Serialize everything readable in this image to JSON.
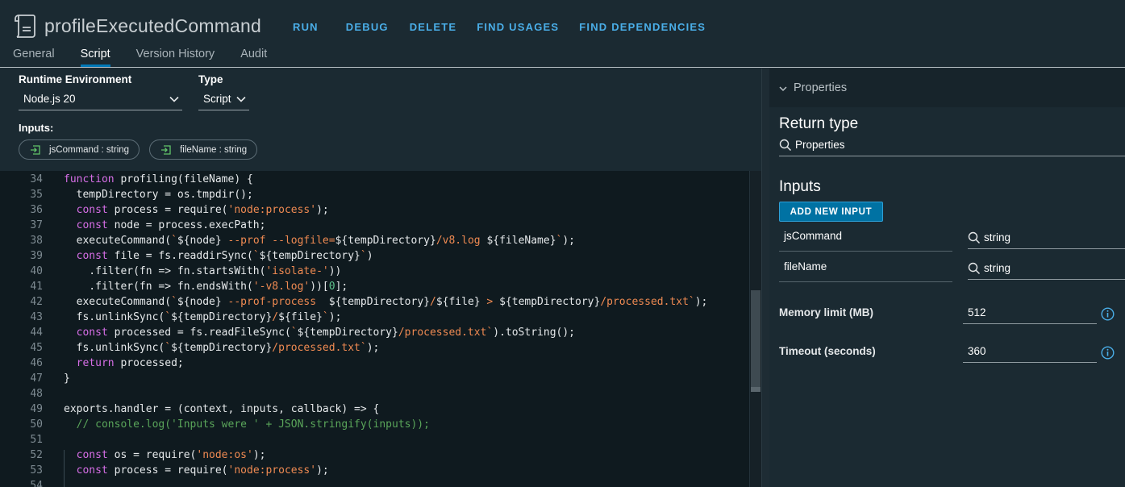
{
  "header": {
    "title": "profileExecutedCommand",
    "actions": [
      "RUN",
      "DEBUG",
      "DELETE",
      "FIND USAGES",
      "FIND DEPENDENCIES"
    ],
    "tabs": [
      "General",
      "Script",
      "Version History",
      "Audit"
    ],
    "active_tab": "Script"
  },
  "config": {
    "runtime_label": "Runtime Environment",
    "runtime_value": "Node.js 20",
    "type_label": "Type",
    "type_value": "Script",
    "inputs_label": "Inputs:",
    "inputs": [
      "jsCommand : string",
      "fileName : string"
    ]
  },
  "editor": {
    "lines": [
      {
        "n": "34",
        "t": "function profiling(fileName) {"
      },
      {
        "n": "35",
        "t": "  tempDirectory = os.tmpdir();"
      },
      {
        "n": "36",
        "t": "  const process = require('node:process');"
      },
      {
        "n": "37",
        "t": "  const node = process.execPath;"
      },
      {
        "n": "38",
        "t": "  executeCommand(`${node} --prof --logfile=${tempDirectory}/v8.log ${fileName}`);"
      },
      {
        "n": "39",
        "t": "  const file = fs.readdirSync(`${tempDirectory}`)"
      },
      {
        "n": "40",
        "t": "    .filter(fn => fn.startsWith('isolate-'))"
      },
      {
        "n": "41",
        "t": "    .filter(fn => fn.endsWith('-v8.log'))[0];"
      },
      {
        "n": "42",
        "t": "  executeCommand(`${node} --prof-process  ${tempDirectory}/${file} > ${tempDirectory}/processed.txt`);"
      },
      {
        "n": "43",
        "t": "  fs.unlinkSync(`${tempDirectory}/${file}`);"
      },
      {
        "n": "44",
        "t": "  const processed = fs.readFileSync(`${tempDirectory}/processed.txt`).toString();"
      },
      {
        "n": "45",
        "t": "  fs.unlinkSync(`${tempDirectory}/processed.txt`);"
      },
      {
        "n": "46",
        "t": "  return processed;"
      },
      {
        "n": "47",
        "t": "}"
      },
      {
        "n": "48",
        "t": ""
      },
      {
        "n": "49",
        "t": "exports.handler = (context, inputs, callback) => {"
      },
      {
        "n": "50",
        "t": "  // console.log('Inputs were ' + JSON.stringify(inputs));"
      },
      {
        "n": "51",
        "t": ""
      },
      {
        "n": "52",
        "t": "  const os = require('node:os');"
      },
      {
        "n": "53",
        "t": "  const process = require('node:process');"
      },
      {
        "n": "54",
        "t": ""
      }
    ]
  },
  "properties": {
    "header": "Properties",
    "return_type_title": "Return type",
    "return_type_value": "Properties",
    "inputs_title": "Inputs",
    "add_input_label": "ADD NEW INPUT",
    "inputs": [
      {
        "name": "jsCommand",
        "type": "string"
      },
      {
        "name": "fileName",
        "type": "string"
      }
    ],
    "memory_label": "Memory limit (MB)",
    "memory_value": "512",
    "timeout_label": "Timeout (seconds)",
    "timeout_value": "360"
  },
  "colors": {
    "accent": "#0072a3",
    "link": "#4aaee8",
    "keyword": "#d66ee6",
    "string": "#ef8a52",
    "number": "#5dc48c",
    "comment": "#5aa55a"
  }
}
